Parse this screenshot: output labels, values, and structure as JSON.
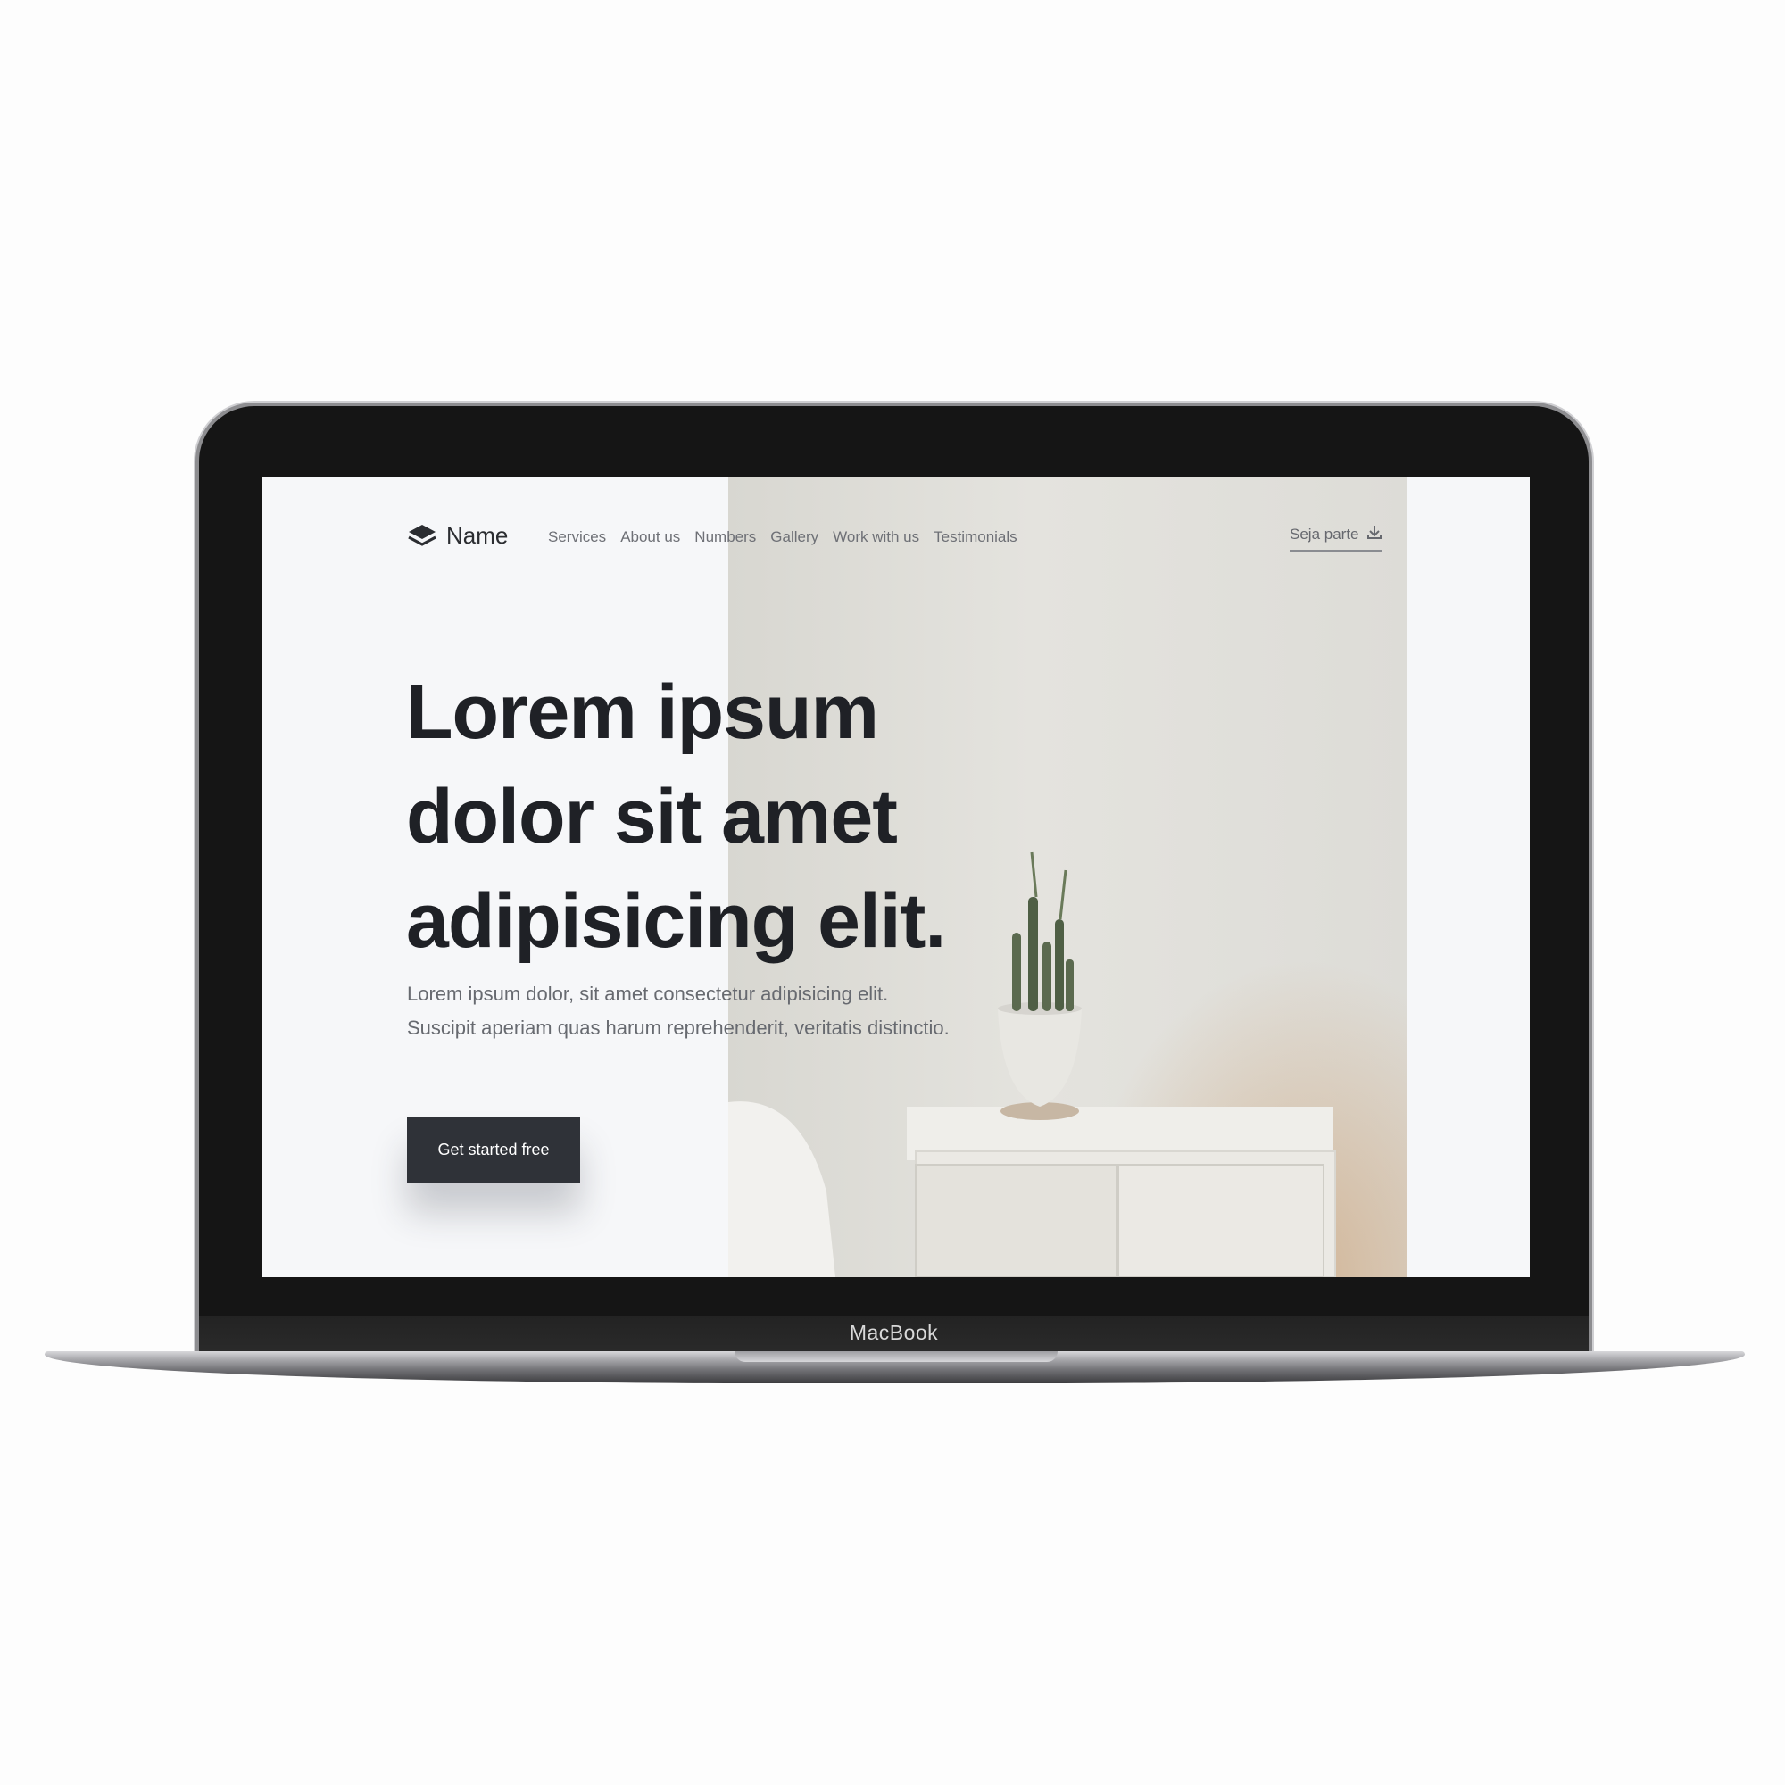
{
  "device": {
    "brand_label": "MacBook"
  },
  "site": {
    "logo_name": "Name",
    "nav": [
      "Services",
      "About us",
      "Numbers",
      "Gallery",
      "Work with us",
      "Testimonials"
    ],
    "cta_link": "Seja parte",
    "cta_icon": "download-icon"
  },
  "hero": {
    "title_lines": [
      "Lorem ipsum",
      "dolor sit amet",
      "adipisicing elit."
    ],
    "subtitle_lines": [
      "Lorem ipsum dolor, sit amet consectetur adipisicing elit.",
      "Suscipit aperiam quas harum reprehenderit, veritatis distinctio."
    ],
    "button_label": "Get started free"
  },
  "colors": {
    "page_bg": "#f6f7f9",
    "text_dark": "#1f2126",
    "button_bg": "#2f3238",
    "nav_text": "#6e7076"
  }
}
